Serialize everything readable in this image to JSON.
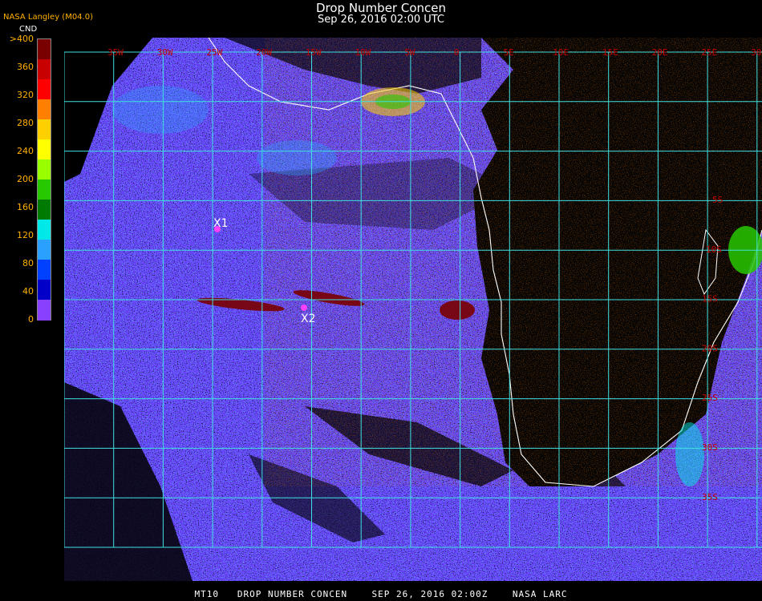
{
  "header": {
    "title": "Drop Number Concen",
    "subtitle": "Sep 26, 2016 02:00 UTC",
    "agency": "NASA Langley (M04.0)"
  },
  "legend": {
    "unit": "CND",
    "labels": [
      ">400",
      "360",
      "320",
      "280",
      "240",
      "200",
      "160",
      "120",
      "80",
      "40",
      "0"
    ],
    "colors": [
      "#7a0000",
      "#c80000",
      "#ff0000",
      "#ff7f00",
      "#ffd000",
      "#ffff00",
      "#99ff00",
      "#28c800",
      "#007a00",
      "#00e8e8",
      "#2aa0ff",
      "#0040ff",
      "#0000c8",
      "#8a40ff"
    ]
  },
  "map": {
    "lon_labels": [
      "35W",
      "30W",
      "25W",
      "20W",
      "15W",
      "10W",
      "5W",
      "0",
      "5E",
      "10E",
      "15E",
      "20E",
      "25E",
      "30E"
    ],
    "lat_labels": [
      "5S",
      "10S",
      "15S",
      "20S",
      "25S",
      "30S",
      "35S"
    ],
    "markers": [
      {
        "label": "X1",
        "color": "#ff40ff"
      },
      {
        "label": "X2",
        "color": "#ff40ff"
      }
    ],
    "grid_color": "#40e0e0",
    "ocean_color": "#6a3cff",
    "coast_color": "#ffffff"
  },
  "footer": "MT10   DROP NUMBER CONCEN    SEP 26, 2016 02:00Z    NASA LARC"
}
